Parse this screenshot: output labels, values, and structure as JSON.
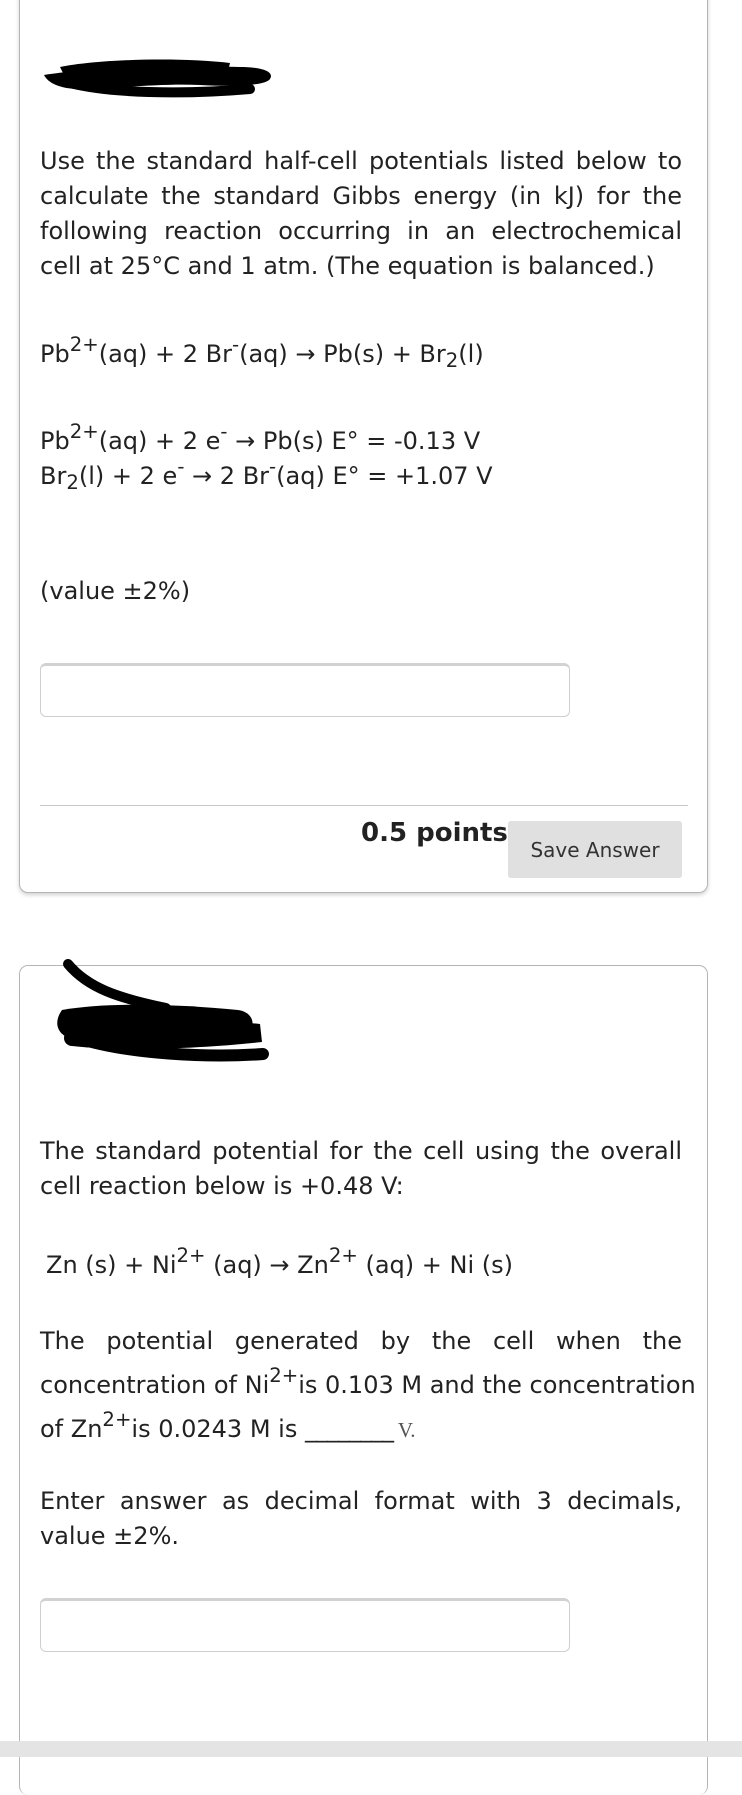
{
  "question1": {
    "intro": "Use the standard half-cell potentials listed below to calculate the standard Gibbs energy (in kJ) for the following reaction occurring in an electrochemical cell at 25°C and 1 atm. (The equation is balanced.)",
    "reaction": {
      "reactant_lead": "Pb",
      "reactant_lead_charge": "2+",
      "reactant_rest": "(aq) + 2 Br",
      "bromide_charge": "-",
      "arrow_segment": "(aq) →  Pb(s) + Br",
      "sub_2": "2",
      "end": "(l)"
    },
    "half1": {
      "species": "Pb",
      "charge": "2+",
      "middle": "(aq) + 2 e",
      "electron_charge": "-",
      "rest": " → Pb(s) E° = -0.13 V"
    },
    "half2": {
      "species": "Br",
      "sub": "2",
      "middle": "(l) + 2 e",
      "electron_charge": "-",
      "mid2": " → 2 Br",
      "bromide_charge": "-",
      "rest": "(aq) E° = +1.07 V"
    },
    "tolerance": "(value ±2%)",
    "answer_value": "",
    "points": "0.5 points",
    "save_label": "Save Answer"
  },
  "question2": {
    "intro": "The standard potential for the cell using the overall cell reaction below is +0.48 V:",
    "reaction": {
      "part1": "Zn (s) + Ni",
      "ni_charge": "2+",
      "part2": " (aq) → Zn",
      "zn_charge": "2+",
      "part3": " (aq) + Ni (s)"
    },
    "body": {
      "line1": "The potential generated by the cell when the",
      "line2_a": "concentration of Ni",
      "line2_charge": "2+",
      "line2_b": " is 0.103 M and the concentration",
      "line3_a": "of Zn",
      "line3_charge": "2+",
      "line3_b": "is 0.0243 M is ",
      "blank": "________",
      "unit": " V."
    },
    "instruction": "Enter answer as decimal format with 3 decimals, value ±2%.",
    "answer_value": ""
  }
}
